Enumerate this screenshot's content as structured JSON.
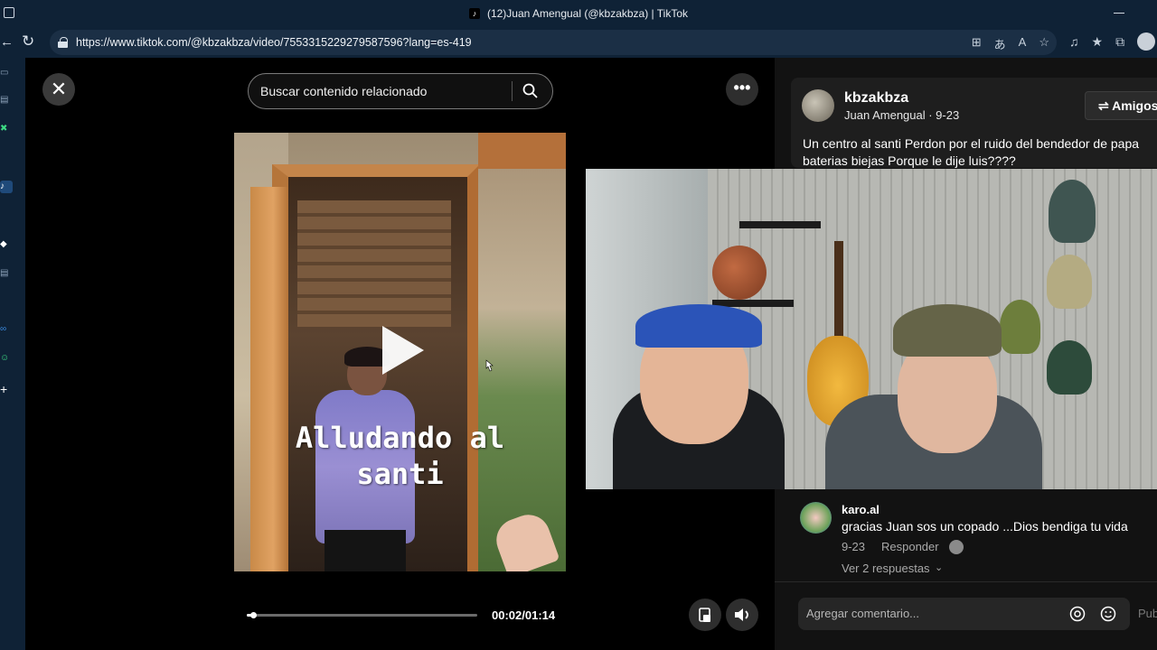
{
  "window": {
    "title": "(12)Juan Amengual (@kbzakbza) | TikTok"
  },
  "browser": {
    "url": "https://www.tiktok.com/@kbzakbza/video/7553315229279587596?lang=es-419"
  },
  "search": {
    "placeholder": "Buscar contenido relacionado"
  },
  "video": {
    "caption_line1": "Alludando al",
    "caption_line2": "santi",
    "current_time": "00:02/01:14",
    "progress_fraction": 0.027
  },
  "author": {
    "username": "kbzakbza",
    "subtitle": "Juan Amengual · 9-23",
    "follow_label": "Amigos",
    "description_line1": "Un centro al santi Perdon por el ruido del bendedor de papa",
    "description_line2": "baterias biejas Porque le dije luis????"
  },
  "comment": {
    "user": "karo.al",
    "text": "gracias Juan sos un copado ...Dios bendiga tu vida",
    "date": "9-23",
    "reply_label": "Responder",
    "more_replies": "Ver 2 respuestas"
  },
  "comment_box": {
    "placeholder": "Agregar comentario...",
    "publish_label": "Pub"
  },
  "icons": {
    "close": "close-icon",
    "search": "search-icon",
    "more": "more-icon",
    "pip": "pip-icon",
    "volume": "volume-icon",
    "mention": "at-icon",
    "emoji": "emoji-icon"
  }
}
